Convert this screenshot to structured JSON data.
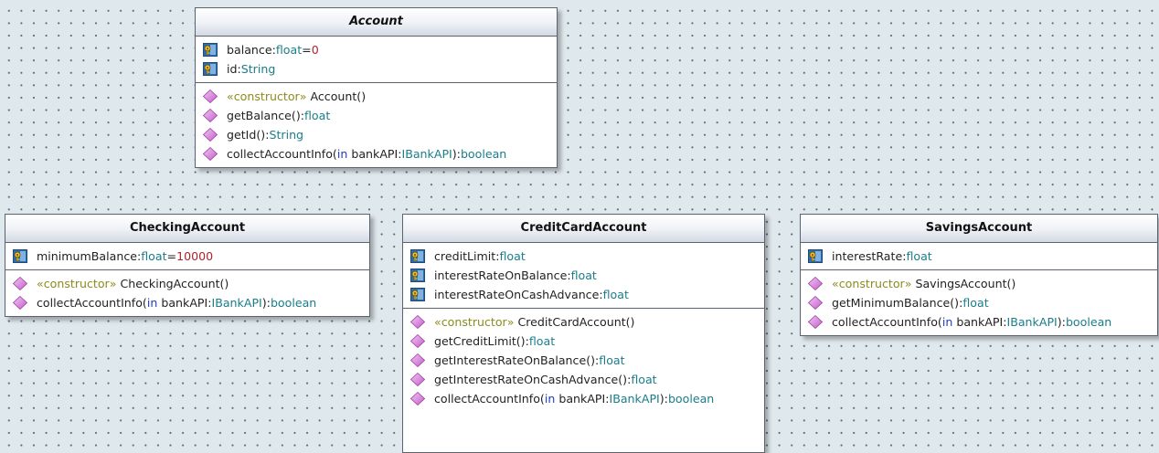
{
  "classes": {
    "account": {
      "name": "Account",
      "attributes": [
        {
          "name": "balance",
          "type": "float",
          "default": "0",
          "icon": "attribute-key-icon"
        },
        {
          "name": "id",
          "type": "String",
          "icon": "attribute-key-icon"
        }
      ],
      "operations": [
        {
          "stereotype": "«constructor»",
          "name": "Account()",
          "icon": "operation-diamond-icon"
        },
        {
          "name": "getBalance():",
          "type": "float",
          "icon": "operation-diamond-icon"
        },
        {
          "name": "getId():",
          "type": "String",
          "icon": "operation-diamond-icon"
        },
        {
          "name": "collectAccountInfo(",
          "direction": "in",
          "param": " bankAPI:",
          "param_type": "IBankAPI",
          "close": "):",
          "type": "boolean",
          "icon": "operation-diamond-icon"
        }
      ]
    },
    "checking": {
      "name": "CheckingAccount",
      "attributes": [
        {
          "name": "minimumBalance",
          "type": "float",
          "default": "10000",
          "icon": "attribute-key-icon"
        }
      ],
      "operations": [
        {
          "stereotype": "«constructor»",
          "name": "CheckingAccount()",
          "icon": "operation-diamond-icon"
        },
        {
          "name": "collectAccountInfo(",
          "direction": "in",
          "param": " bankAPI:",
          "param_type": "IBankAPI",
          "close": "):",
          "type": "boolean",
          "icon": "operation-diamond-icon"
        }
      ]
    },
    "creditcard": {
      "name": "CreditCardAccount",
      "attributes": [
        {
          "name": "creditLimit",
          "type": "float",
          "icon": "attribute-key-icon"
        },
        {
          "name": "interestRateOnBalance",
          "type": "float",
          "icon": "attribute-key-icon"
        },
        {
          "name": "interestRateOnCashAdvance",
          "type": "float",
          "icon": "attribute-key-icon"
        }
      ],
      "operations": [
        {
          "stereotype": "«constructor»",
          "name": "CreditCardAccount()",
          "icon": "operation-diamond-icon"
        },
        {
          "name": "getCreditLimit():",
          "type": "float",
          "icon": "operation-diamond-icon"
        },
        {
          "name": "getInterestRateOnBalance():",
          "type": "float",
          "icon": "operation-diamond-icon"
        },
        {
          "name": "getInterestRateOnCashAdvance():",
          "type": "float",
          "icon": "operation-diamond-icon"
        },
        {
          "name": "collectAccountInfo(",
          "direction": "in",
          "param": " bankAPI:",
          "param_type": "IBankAPI",
          "close": "):",
          "type": "boolean",
          "icon": "operation-diamond-icon"
        }
      ]
    },
    "savings": {
      "name": "SavingsAccount",
      "attributes": [
        {
          "name": "interestRate",
          "type": "float",
          "icon": "attribute-key-icon"
        }
      ],
      "operations": [
        {
          "stereotype": "«constructor»",
          "name": "SavingsAccount()",
          "icon": "operation-diamond-icon"
        },
        {
          "name": "getMinimumBalance():",
          "type": "float",
          "icon": "operation-diamond-icon"
        },
        {
          "name": "collectAccountInfo(",
          "direction": "in",
          "param": " bankAPI:",
          "param_type": "IBankAPI",
          "close": "):",
          "type": "boolean",
          "icon": "operation-diamond-icon"
        }
      ]
    }
  },
  "colors": {
    "canvas": "#dfe8ec",
    "keyword": "#8f8a1e",
    "type": "#1a7d8a",
    "direction": "#1f3fbf",
    "default_value": "#b0222d",
    "operation_icon": "#d47ad8",
    "attribute_icon": "#2f6da8"
  }
}
